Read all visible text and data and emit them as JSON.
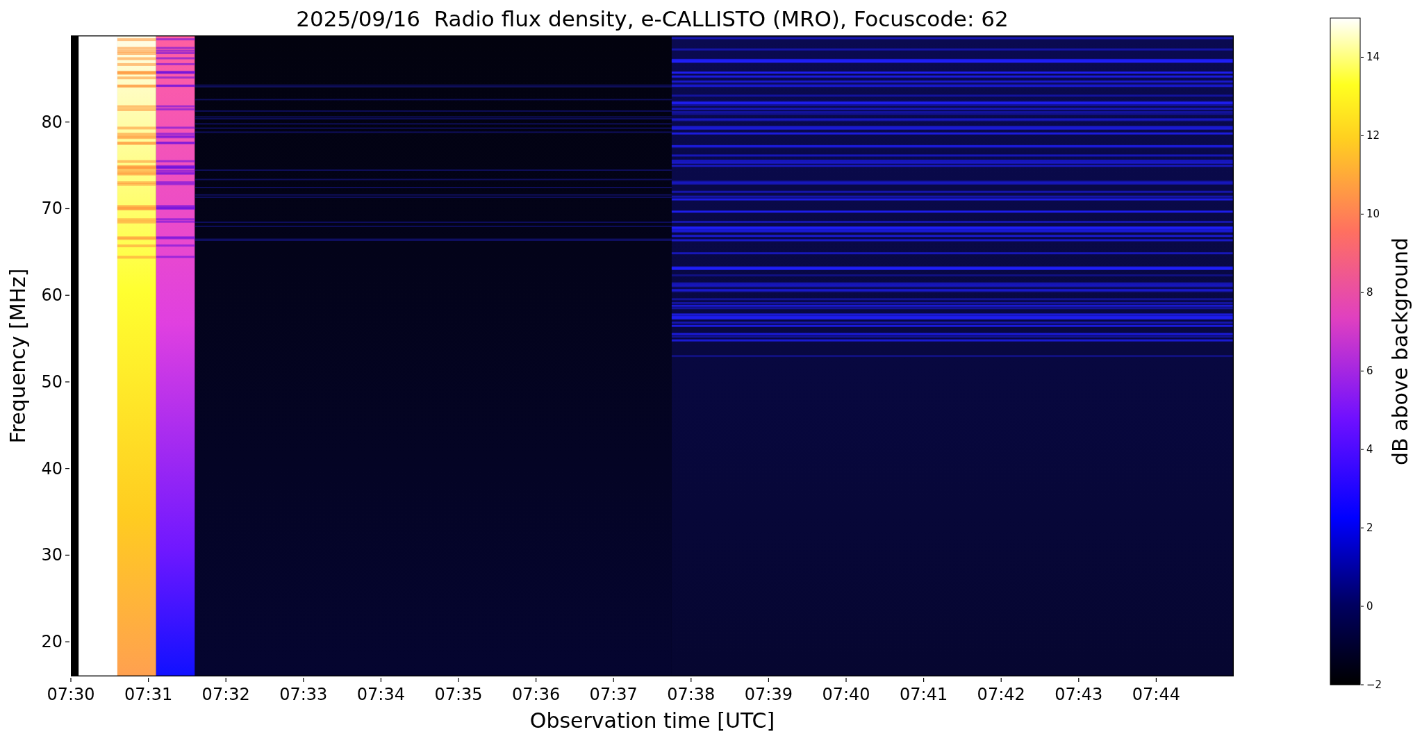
{
  "title": "2025/09/16  Radio flux density, e-CALLISTO (MRO), Focuscode: 62",
  "xlabel": "Observation time [UTC]",
  "ylabel": "Frequency [MHz]",
  "xticks": [
    "07:30",
    "07:31",
    "07:32",
    "07:33",
    "07:34",
    "07:35",
    "07:36",
    "07:37",
    "07:38",
    "07:39",
    "07:40",
    "07:41",
    "07:42",
    "07:43",
    "07:44"
  ],
  "yticks": [
    "80",
    "70",
    "60",
    "50",
    "40",
    "30",
    "20"
  ],
  "colorbar": {
    "label": "dB above background",
    "ticks": [
      "14",
      "12",
      "10",
      "8",
      "6",
      "4",
      "2",
      "0",
      "−2"
    ]
  }
}
